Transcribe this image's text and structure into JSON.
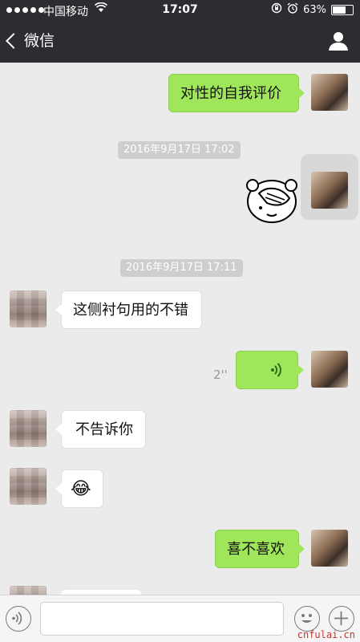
{
  "status_bar": {
    "carrier": "中国移动",
    "time": "17:07",
    "battery": "63%",
    "battery_level": 0.63
  },
  "nav": {
    "back_label": "微信",
    "title": "",
    "profile_icon": "profile-icon"
  },
  "messages": [
    {
      "type": "text",
      "sender": "me",
      "text": "对性的自我评价"
    },
    {
      "type": "timestamp",
      "text": "2016年9月17日 17:02"
    },
    {
      "type": "sticker",
      "sender": "me",
      "icon": "facepalm-bear-sticker"
    },
    {
      "type": "timestamp",
      "text": "2016年9月17日 17:11"
    },
    {
      "type": "text",
      "sender": "her",
      "text": "这侧衬句用的不错"
    },
    {
      "type": "voice",
      "sender": "me",
      "duration": "2''"
    },
    {
      "type": "text",
      "sender": "her",
      "text": "不告诉你"
    },
    {
      "type": "emoji",
      "sender": "her",
      "emoji": "😂"
    },
    {
      "type": "text",
      "sender": "me",
      "text": "喜不喜欢"
    }
  ],
  "input_bar": {
    "voice_icon": "voice-input-icon",
    "emoji_icon": "emoji-icon",
    "plus_icon": "plus-icon",
    "input_value": ""
  },
  "watermark": "cnfulai.cn"
}
